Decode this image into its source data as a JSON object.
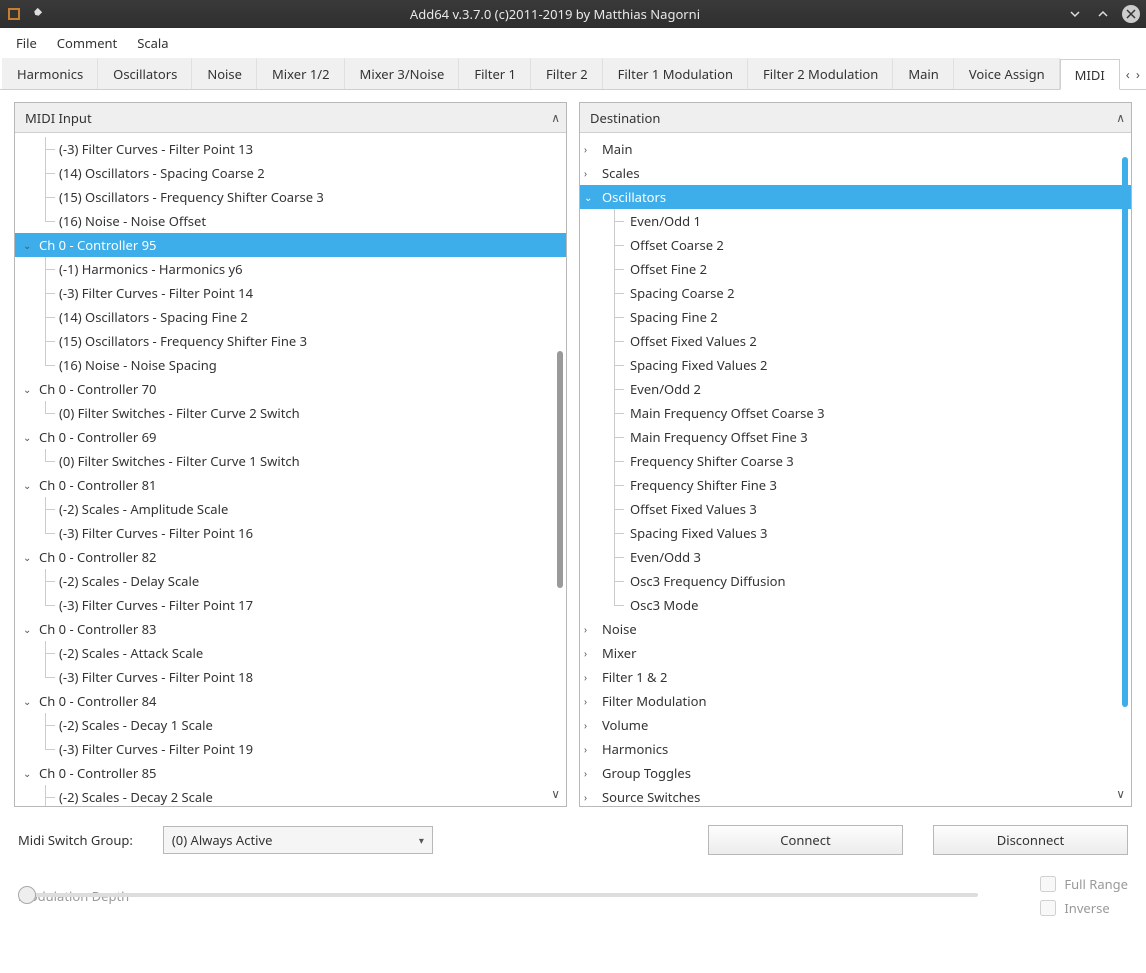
{
  "titlebar": {
    "title": "Add64  v.3.7.0   (c)2011-2019 by Matthias Nagorni"
  },
  "menu": [
    "File",
    "Comment",
    "Scala"
  ],
  "tabs": [
    "Harmonics",
    "Oscillators",
    "Noise",
    "Mixer 1/2",
    "Mixer 3/Noise",
    "Filter 1",
    "Filter 2",
    "Filter 1 Modulation",
    "Filter 2 Modulation",
    "Main",
    "Voice Assign",
    "MIDI"
  ],
  "active_tab": "MIDI",
  "midi_input": {
    "header": "MIDI Input",
    "items": [
      {
        "type": "child",
        "label": "(-3) Filter Curves - Filter Point 13"
      },
      {
        "type": "child",
        "label": "(14) Oscillators - Spacing Coarse 2"
      },
      {
        "type": "child",
        "label": "(15) Oscillators - Frequency Shifter Coarse 3"
      },
      {
        "type": "child",
        "label": "(16) Noise - Noise Offset",
        "last": true
      },
      {
        "type": "parent",
        "label": "Ch 0 - Controller 95",
        "selected": true
      },
      {
        "type": "child",
        "label": "(-1) Harmonics - Harmonics y6"
      },
      {
        "type": "child",
        "label": "(-3) Filter Curves - Filter Point 14"
      },
      {
        "type": "child",
        "label": "(14) Oscillators - Spacing Fine 2"
      },
      {
        "type": "child",
        "label": "(15) Oscillators - Frequency Shifter Fine 3"
      },
      {
        "type": "child",
        "label": "(16) Noise - Noise Spacing",
        "last": true
      },
      {
        "type": "parent",
        "label": "Ch 0 - Controller 70"
      },
      {
        "type": "child",
        "label": "(0) Filter Switches - Filter Curve 2  Switch",
        "last": true
      },
      {
        "type": "parent",
        "label": "Ch 0 - Controller 69"
      },
      {
        "type": "child",
        "label": "(0) Filter Switches - Filter Curve 1  Switch",
        "last": true
      },
      {
        "type": "parent",
        "label": "Ch 0 - Controller 81"
      },
      {
        "type": "child",
        "label": "(-2) Scales - Amplitude Scale"
      },
      {
        "type": "child",
        "label": "(-3) Filter Curves - Filter Point 16",
        "last": true
      },
      {
        "type": "parent",
        "label": "Ch 0 - Controller 82"
      },
      {
        "type": "child",
        "label": "(-2) Scales - Delay Scale"
      },
      {
        "type": "child",
        "label": "(-3) Filter Curves - Filter Point 17",
        "last": true
      },
      {
        "type": "parent",
        "label": "Ch 0 - Controller 83"
      },
      {
        "type": "child",
        "label": "(-2) Scales - Attack Scale"
      },
      {
        "type": "child",
        "label": "(-3) Filter Curves - Filter Point 18",
        "last": true
      },
      {
        "type": "parent",
        "label": "Ch 0 - Controller 84"
      },
      {
        "type": "child",
        "label": "(-2) Scales - Decay 1 Scale"
      },
      {
        "type": "child",
        "label": "(-3) Filter Curves - Filter Point 19",
        "last": true
      },
      {
        "type": "parent",
        "label": "Ch 0 - Controller 85"
      },
      {
        "type": "child",
        "label": "(-2) Scales - Decay 2 Scale"
      }
    ]
  },
  "destination": {
    "header": "Destination",
    "items": [
      {
        "type": "collapsed",
        "label": "Main"
      },
      {
        "type": "collapsed",
        "label": "Scales"
      },
      {
        "type": "expanded",
        "label": "Oscillators",
        "selected": true
      },
      {
        "type": "leaf",
        "label": "Even/Odd 1"
      },
      {
        "type": "leaf",
        "label": "Offset Coarse 2"
      },
      {
        "type": "leaf",
        "label": "Offset Fine 2"
      },
      {
        "type": "leaf",
        "label": "Spacing Coarse 2"
      },
      {
        "type": "leaf",
        "label": "Spacing Fine 2"
      },
      {
        "type": "leaf",
        "label": "Offset Fixed Values 2"
      },
      {
        "type": "leaf",
        "label": "Spacing Fixed Values 2"
      },
      {
        "type": "leaf",
        "label": "Even/Odd 2"
      },
      {
        "type": "leaf",
        "label": "Main Frequency Offset Coarse 3"
      },
      {
        "type": "leaf",
        "label": "Main Frequency Offset Fine 3"
      },
      {
        "type": "leaf",
        "label": "Frequency Shifter Coarse 3"
      },
      {
        "type": "leaf",
        "label": "Frequency Shifter Fine 3"
      },
      {
        "type": "leaf",
        "label": "Offset Fixed Values 3"
      },
      {
        "type": "leaf",
        "label": "Spacing Fixed Values 3"
      },
      {
        "type": "leaf",
        "label": "Even/Odd 3"
      },
      {
        "type": "leaf",
        "label": "Osc3 Frequency Diffusion"
      },
      {
        "type": "leaf",
        "label": "Osc3 Mode",
        "last": true
      },
      {
        "type": "collapsed",
        "label": "Noise"
      },
      {
        "type": "collapsed",
        "label": "Mixer"
      },
      {
        "type": "collapsed",
        "label": "Filter 1 & 2"
      },
      {
        "type": "collapsed",
        "label": "Filter Modulation"
      },
      {
        "type": "collapsed",
        "label": "Volume"
      },
      {
        "type": "collapsed",
        "label": "Harmonics"
      },
      {
        "type": "collapsed",
        "label": "Group Toggles"
      },
      {
        "type": "collapsed",
        "label": "Source Switches"
      }
    ]
  },
  "footer": {
    "midi_switch_label": "Midi Switch Group:",
    "combo_value": "(0) Always Active",
    "connect": "Connect",
    "disconnect": "Disconnect",
    "mod_depth": "Modulation Depth",
    "full_range": "Full Range",
    "inverse": "Inverse"
  }
}
